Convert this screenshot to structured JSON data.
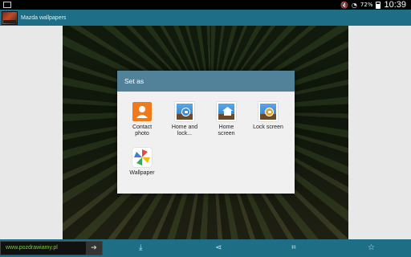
{
  "status_bar": {
    "battery_percent": "72%",
    "time": "10:39"
  },
  "app_bar": {
    "title": "Mazda wallpapers"
  },
  "dialog": {
    "title": "Set as",
    "options": [
      {
        "label_line1": "Contact",
        "label_line2": "photo",
        "icon": "contact-icon"
      },
      {
        "label_line1": "Home and",
        "label_line2": "lock...",
        "icon": "home-and-lock-icon"
      },
      {
        "label_line1": "Home",
        "label_line2": "screen",
        "icon": "home-screen-icon"
      },
      {
        "label_line1": "Lock screen",
        "label_line2": "",
        "icon": "lock-screen-icon"
      },
      {
        "label_line1": "Wallpaper",
        "label_line2": "",
        "icon": "wallpaper-icon"
      }
    ]
  },
  "bottom_bar": {
    "ad_text": "www.pozdrawiamy.pl",
    "icons": [
      "download-icon",
      "share-icon",
      "crop-icon",
      "star-icon"
    ]
  },
  "colors": {
    "app_bar": "#1e6e86",
    "dialog_header": "#52829a",
    "contact_orange": "#f07a1a"
  }
}
